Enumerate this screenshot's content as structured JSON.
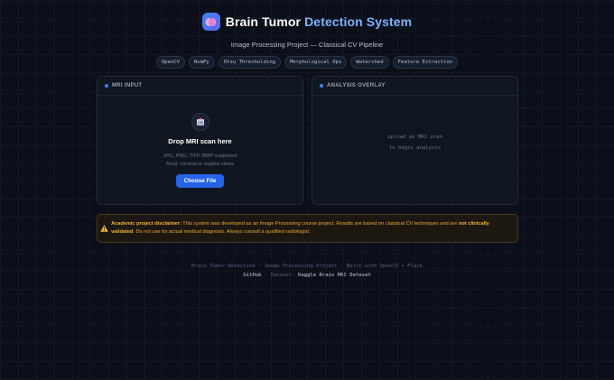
{
  "header": {
    "title_main": "Brain Tumor",
    "title_accent": "Detection System",
    "subtitle": "Image Processing Project — Classical CV Pipeline",
    "tags": [
      "OpenCV",
      "NumPy",
      "Otsu Thresholding",
      "Morphological Ops",
      "Watershed",
      "Feature Extraction"
    ]
  },
  "input_panel": {
    "title": "MRI INPUT",
    "drop_title": "Drop MRI scan here",
    "formats": "JPG, PNG, TIFF, BMP supported",
    "views": "Axial, coronal or sagittal views",
    "button": "Choose File"
  },
  "overlay_panel": {
    "title": "ANALYSIS OVERLAY",
    "placeholder_line1": "upload an MRI scan",
    "placeholder_line2": "to begin analysis"
  },
  "disclaimer": {
    "label": "Academic project disclaimer:",
    "text1": "This system was developed as an Image Processing course project. Results are based on classical CV techniques and are",
    "emph": "not clinically validated",
    "text2": ". Do not use for actual medical diagnosis. Always consult a qualified radiologist."
  },
  "footer": {
    "line1": "Brain Tumor Detection · Image Processing Project · Built with OpenCV + Flask",
    "github": "GitHub",
    "sep": " · Dataset: ",
    "dataset": "Kaggle Brain MRI Dataset"
  },
  "colors": {
    "background": "#0b0f19",
    "accent": "#3b82f6",
    "title_accent": "#7ab3ff",
    "warning": "#e8a830"
  },
  "icons": {
    "logo": "brain-icon",
    "drop": "image-upload-icon",
    "warning": "warning-triangle-icon"
  }
}
